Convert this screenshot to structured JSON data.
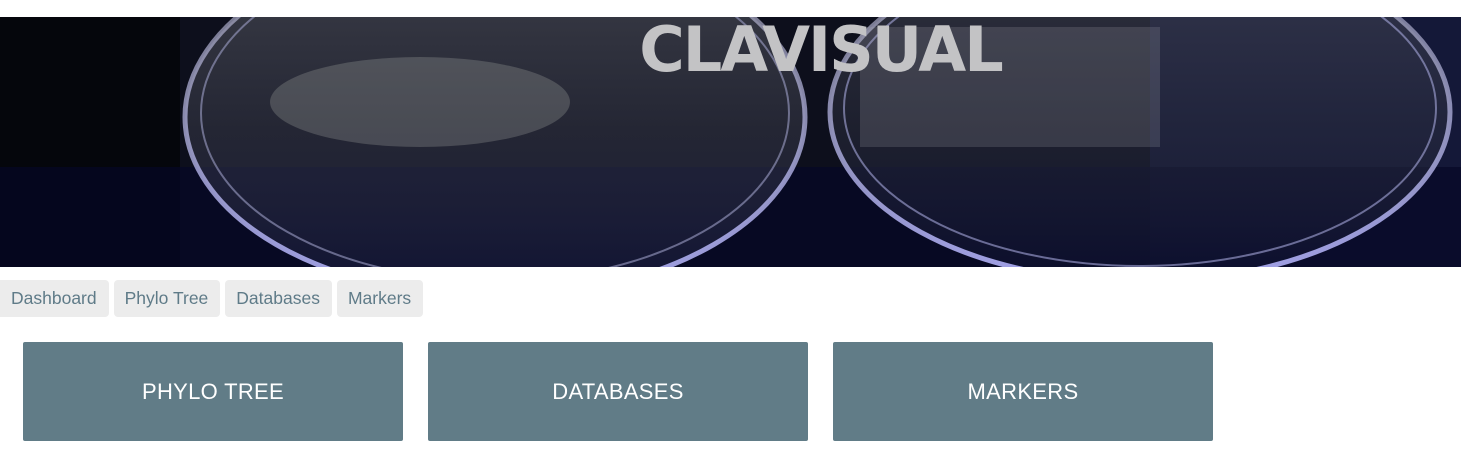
{
  "header": {
    "title": "CLAVISUAL",
    "banner_image": "petri-dishes-photo"
  },
  "nav": {
    "items": [
      {
        "label": "Dashboard"
      },
      {
        "label": "Phylo Tree"
      },
      {
        "label": "Databases"
      },
      {
        "label": "Markers"
      }
    ]
  },
  "tiles": [
    {
      "label": "PHYLO TREE"
    },
    {
      "label": "DATABASES"
    },
    {
      "label": "MARKERS"
    }
  ],
  "colors": {
    "tile_bg": "#617c87",
    "nav_bg": "#ececec",
    "nav_text": "#5f7b88",
    "title_text": "#c3c3c5"
  }
}
